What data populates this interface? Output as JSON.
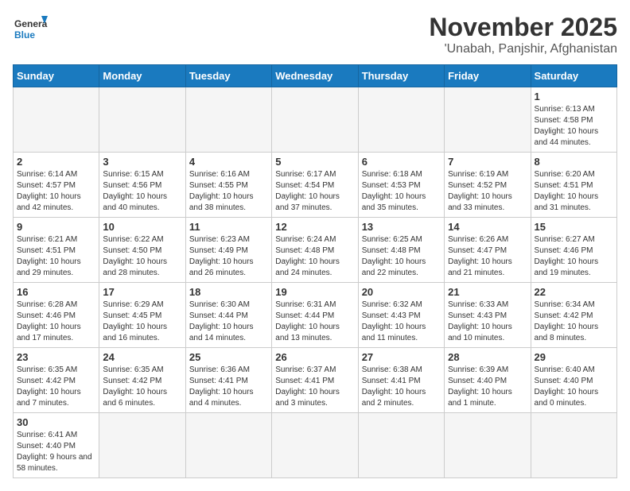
{
  "logo": {
    "text_general": "General",
    "text_blue": "Blue"
  },
  "title": "November 2025",
  "location": "'Unabah, Panjshir, Afghanistan",
  "weekdays": [
    "Sunday",
    "Monday",
    "Tuesday",
    "Wednesday",
    "Thursday",
    "Friday",
    "Saturday"
  ],
  "weeks": [
    [
      {
        "day": "",
        "info": ""
      },
      {
        "day": "",
        "info": ""
      },
      {
        "day": "",
        "info": ""
      },
      {
        "day": "",
        "info": ""
      },
      {
        "day": "",
        "info": ""
      },
      {
        "day": "",
        "info": ""
      },
      {
        "day": "1",
        "info": "Sunrise: 6:13 AM\nSunset: 4:58 PM\nDaylight: 10 hours and 44 minutes."
      }
    ],
    [
      {
        "day": "2",
        "info": "Sunrise: 6:14 AM\nSunset: 4:57 PM\nDaylight: 10 hours and 42 minutes."
      },
      {
        "day": "3",
        "info": "Sunrise: 6:15 AM\nSunset: 4:56 PM\nDaylight: 10 hours and 40 minutes."
      },
      {
        "day": "4",
        "info": "Sunrise: 6:16 AM\nSunset: 4:55 PM\nDaylight: 10 hours and 38 minutes."
      },
      {
        "day": "5",
        "info": "Sunrise: 6:17 AM\nSunset: 4:54 PM\nDaylight: 10 hours and 37 minutes."
      },
      {
        "day": "6",
        "info": "Sunrise: 6:18 AM\nSunset: 4:53 PM\nDaylight: 10 hours and 35 minutes."
      },
      {
        "day": "7",
        "info": "Sunrise: 6:19 AM\nSunset: 4:52 PM\nDaylight: 10 hours and 33 minutes."
      },
      {
        "day": "8",
        "info": "Sunrise: 6:20 AM\nSunset: 4:51 PM\nDaylight: 10 hours and 31 minutes."
      }
    ],
    [
      {
        "day": "9",
        "info": "Sunrise: 6:21 AM\nSunset: 4:51 PM\nDaylight: 10 hours and 29 minutes."
      },
      {
        "day": "10",
        "info": "Sunrise: 6:22 AM\nSunset: 4:50 PM\nDaylight: 10 hours and 28 minutes."
      },
      {
        "day": "11",
        "info": "Sunrise: 6:23 AM\nSunset: 4:49 PM\nDaylight: 10 hours and 26 minutes."
      },
      {
        "day": "12",
        "info": "Sunrise: 6:24 AM\nSunset: 4:48 PM\nDaylight: 10 hours and 24 minutes."
      },
      {
        "day": "13",
        "info": "Sunrise: 6:25 AM\nSunset: 4:48 PM\nDaylight: 10 hours and 22 minutes."
      },
      {
        "day": "14",
        "info": "Sunrise: 6:26 AM\nSunset: 4:47 PM\nDaylight: 10 hours and 21 minutes."
      },
      {
        "day": "15",
        "info": "Sunrise: 6:27 AM\nSunset: 4:46 PM\nDaylight: 10 hours and 19 minutes."
      }
    ],
    [
      {
        "day": "16",
        "info": "Sunrise: 6:28 AM\nSunset: 4:46 PM\nDaylight: 10 hours and 17 minutes."
      },
      {
        "day": "17",
        "info": "Sunrise: 6:29 AM\nSunset: 4:45 PM\nDaylight: 10 hours and 16 minutes."
      },
      {
        "day": "18",
        "info": "Sunrise: 6:30 AM\nSunset: 4:44 PM\nDaylight: 10 hours and 14 minutes."
      },
      {
        "day": "19",
        "info": "Sunrise: 6:31 AM\nSunset: 4:44 PM\nDaylight: 10 hours and 13 minutes."
      },
      {
        "day": "20",
        "info": "Sunrise: 6:32 AM\nSunset: 4:43 PM\nDaylight: 10 hours and 11 minutes."
      },
      {
        "day": "21",
        "info": "Sunrise: 6:33 AM\nSunset: 4:43 PM\nDaylight: 10 hours and 10 minutes."
      },
      {
        "day": "22",
        "info": "Sunrise: 6:34 AM\nSunset: 4:42 PM\nDaylight: 10 hours and 8 minutes."
      }
    ],
    [
      {
        "day": "23",
        "info": "Sunrise: 6:35 AM\nSunset: 4:42 PM\nDaylight: 10 hours and 7 minutes."
      },
      {
        "day": "24",
        "info": "Sunrise: 6:35 AM\nSunset: 4:42 PM\nDaylight: 10 hours and 6 minutes."
      },
      {
        "day": "25",
        "info": "Sunrise: 6:36 AM\nSunset: 4:41 PM\nDaylight: 10 hours and 4 minutes."
      },
      {
        "day": "26",
        "info": "Sunrise: 6:37 AM\nSunset: 4:41 PM\nDaylight: 10 hours and 3 minutes."
      },
      {
        "day": "27",
        "info": "Sunrise: 6:38 AM\nSunset: 4:41 PM\nDaylight: 10 hours and 2 minutes."
      },
      {
        "day": "28",
        "info": "Sunrise: 6:39 AM\nSunset: 4:40 PM\nDaylight: 10 hours and 1 minute."
      },
      {
        "day": "29",
        "info": "Sunrise: 6:40 AM\nSunset: 4:40 PM\nDaylight: 10 hours and 0 minutes."
      }
    ],
    [
      {
        "day": "30",
        "info": "Sunrise: 6:41 AM\nSunset: 4:40 PM\nDaylight: 9 hours and 58 minutes."
      },
      {
        "day": "",
        "info": ""
      },
      {
        "day": "",
        "info": ""
      },
      {
        "day": "",
        "info": ""
      },
      {
        "day": "",
        "info": ""
      },
      {
        "day": "",
        "info": ""
      },
      {
        "day": "",
        "info": ""
      }
    ]
  ]
}
